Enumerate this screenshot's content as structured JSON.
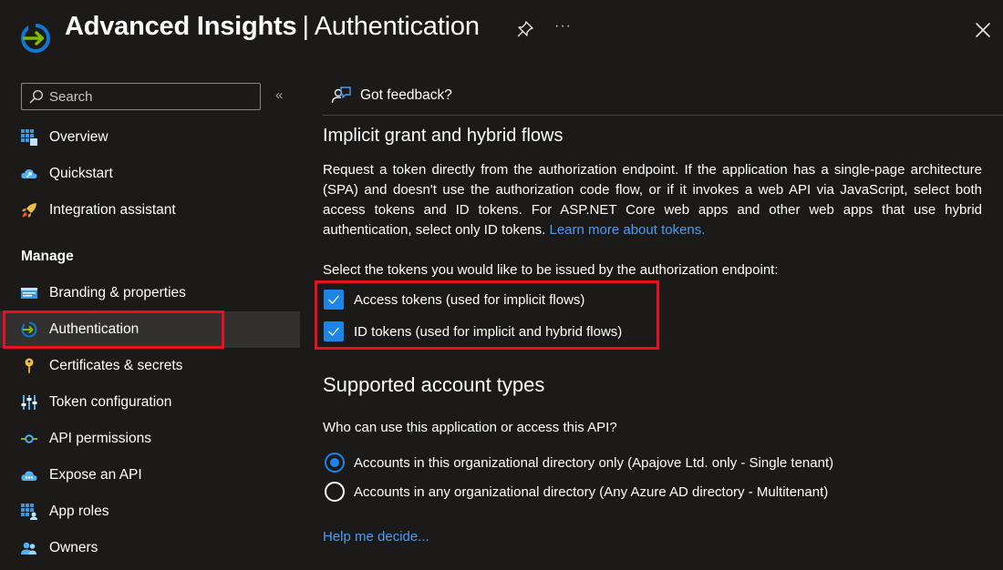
{
  "header": {
    "app_name": "Advanced Insights",
    "separator": "|",
    "page_name": "Authentication",
    "more_label": "···"
  },
  "sidebar": {
    "search_placeholder": "Search",
    "collapse_label": "«",
    "items_top": [
      {
        "label": "Overview",
        "icon": "overview-icon"
      },
      {
        "label": "Quickstart",
        "icon": "quickstart-icon"
      },
      {
        "label": "Integration assistant",
        "icon": "rocket-icon"
      }
    ],
    "manage_title": "Manage",
    "items_manage": [
      {
        "label": "Branding & properties",
        "icon": "branding-icon"
      },
      {
        "label": "Authentication",
        "icon": "authentication-icon",
        "active": true
      },
      {
        "label": "Certificates & secrets",
        "icon": "key-icon"
      },
      {
        "label": "Token configuration",
        "icon": "token-config-icon"
      },
      {
        "label": "API permissions",
        "icon": "api-permissions-icon"
      },
      {
        "label": "Expose an API",
        "icon": "cloud-api-icon"
      },
      {
        "label": "App roles",
        "icon": "app-roles-icon"
      },
      {
        "label": "Owners",
        "icon": "owners-icon"
      }
    ]
  },
  "main": {
    "feedback_label": "Got feedback?",
    "implicit": {
      "title": "Implicit grant and hybrid flows",
      "description": "Request a token directly from the authorization endpoint. If the application has a single-page architecture (SPA) and doesn't use the authorization code flow, or if it invokes a web API via JavaScript, select both access tokens and ID tokens. For ASP.NET Core web apps and other web apps that use hybrid authentication, select only ID tokens.",
      "learn_more": "Learn more about tokens.",
      "select_label": "Select the tokens you would like to be issued by the authorization endpoint:",
      "access_tokens_label": "Access tokens (used for implicit flows)",
      "access_tokens_checked": true,
      "id_tokens_label": "ID tokens (used for implicit and hybrid flows)",
      "id_tokens_checked": true
    },
    "account_types": {
      "title": "Supported account types",
      "question": "Who can use this application or access this API?",
      "option_single": "Accounts in this organizational directory only (Apajove Ltd. only - Single tenant)",
      "option_multi": "Accounts in any organizational directory (Any Azure AD directory - Multitenant)",
      "selected": "single",
      "help_link": "Help me decide..."
    }
  },
  "colors": {
    "background": "#1b1a19",
    "accent": "#1c86e8",
    "link": "#479ef5",
    "highlight": "#e81123",
    "active_item": "#323130"
  }
}
